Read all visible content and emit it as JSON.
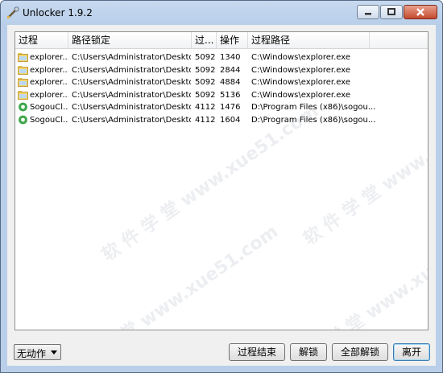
{
  "window": {
    "title": "Unlocker 1.9.2"
  },
  "list": {
    "columns": [
      "过程",
      "路径锁定",
      "过...",
      "操作",
      "过程路径"
    ],
    "rows": [
      {
        "icon": "folder-icon",
        "process": "explorer...",
        "path": "C:\\Users\\Administrator\\Desktop",
        "pid": "5092",
        "handle": "1340",
        "process_path": "C:\\Windows\\explorer.exe"
      },
      {
        "icon": "folder-icon",
        "process": "explorer...",
        "path": "C:\\Users\\Administrator\\Deskto...",
        "pid": "5092",
        "handle": "2844",
        "process_path": "C:\\Windows\\explorer.exe"
      },
      {
        "icon": "folder-icon",
        "process": "explorer...",
        "path": "C:\\Users\\Administrator\\Deskto...",
        "pid": "5092",
        "handle": "4884",
        "process_path": "C:\\Windows\\explorer.exe"
      },
      {
        "icon": "folder-icon",
        "process": "explorer...",
        "path": "C:\\Users\\Administrator\\Deskto...",
        "pid": "5092",
        "handle": "5136",
        "process_path": "C:\\Windows\\explorer.exe"
      },
      {
        "icon": "sogou-icon",
        "process": "SogouCl...",
        "path": "C:\\Users\\Administrator\\Desktop",
        "pid": "4112",
        "handle": "1476",
        "process_path": "D:\\Program Files (x86)\\sogou..."
      },
      {
        "icon": "sogou-icon",
        "process": "SogouCl...",
        "path": "C:\\Users\\Administrator\\Desktop",
        "pid": "4112",
        "handle": "1604",
        "process_path": "D:\\Program Files (x86)\\sogou..."
      }
    ]
  },
  "footer": {
    "action_select": "无动作",
    "buttons": {
      "kill_process": "过程结束",
      "unlock": "解锁",
      "unlock_all": "全部解锁",
      "quit": "离开"
    }
  },
  "watermark": {
    "text": "软 件 学 堂  www.xue51.com"
  }
}
